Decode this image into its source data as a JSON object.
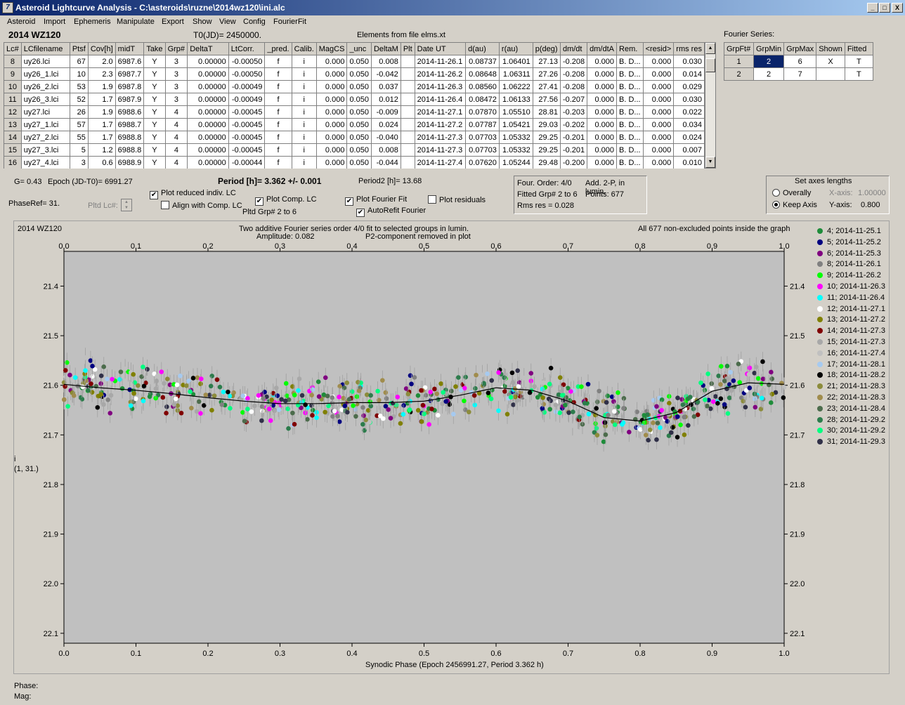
{
  "window": {
    "title": "Asteroid Lightcurve Analysis - C:\\asteroids\\ruzne\\2014wz120\\ini.alc",
    "icon_glyph": "7",
    "buttons": [
      "_",
      "□",
      "X"
    ]
  },
  "menu": [
    "Asteroid",
    "Import",
    "Ephemeris",
    "Manipulate",
    "Export",
    "Show",
    "View",
    "Config",
    "FourierFit"
  ],
  "header": {
    "object": "2014 WZ120",
    "t0": "T0(JD)= 2450000.",
    "elements": "Elements from file elms.xt"
  },
  "lc_table": {
    "columns": [
      "Lc#",
      "LCfilename",
      "Ptsf",
      "Cov[h]",
      "midT",
      "Take",
      "Grp#",
      "DeltaT",
      "LtCorr.",
      "_pred.",
      "Calib.",
      "MagCS",
      "_unc",
      "DeltaM",
      "Plt",
      "Date UT",
      "d(au)",
      "r(au)",
      "p(deg)",
      "dm/dt",
      "dm/dtA",
      "Rem.",
      "<resid>",
      "rms res"
    ],
    "rows": [
      [
        "8",
        "uy26.lci",
        "67",
        "2.0",
        "6987.6",
        "Y",
        "3",
        "0.00000",
        "-0.00050",
        "f",
        "i",
        "0.000",
        "0.050",
        "0.008",
        "",
        "2014-11-26.1",
        "0.08737",
        "1.06401",
        "27.13",
        "-0.208",
        "0.000",
        "B. D...",
        "0.000",
        "0.030"
      ],
      [
        "9",
        "uy26_1.lci",
        "10",
        "2.3",
        "6987.7",
        "Y",
        "3",
        "0.00000",
        "-0.00050",
        "f",
        "i",
        "0.000",
        "0.050",
        "-0.042",
        "",
        "2014-11-26.2",
        "0.08648",
        "1.06311",
        "27.26",
        "-0.208",
        "0.000",
        "B. D...",
        "0.000",
        "0.014"
      ],
      [
        "10",
        "uy26_2.lci",
        "53",
        "1.9",
        "6987.8",
        "Y",
        "3",
        "0.00000",
        "-0.00049",
        "f",
        "i",
        "0.000",
        "0.050",
        "0.037",
        "",
        "2014-11-26.3",
        "0.08560",
        "1.06222",
        "27.41",
        "-0.208",
        "0.000",
        "B. D...",
        "0.000",
        "0.029"
      ],
      [
        "11",
        "uy26_3.lci",
        "52",
        "1.7",
        "6987.9",
        "Y",
        "3",
        "0.00000",
        "-0.00049",
        "f",
        "i",
        "0.000",
        "0.050",
        "0.012",
        "",
        "2014-11-26.4",
        "0.08472",
        "1.06133",
        "27.56",
        "-0.207",
        "0.000",
        "B. D...",
        "0.000",
        "0.030"
      ],
      [
        "12",
        "uy27.lci",
        "26",
        "1.9",
        "6988.6",
        "Y",
        "4",
        "0.00000",
        "-0.00045",
        "f",
        "i",
        "0.000",
        "0.050",
        "-0.009",
        "",
        "2014-11-27.1",
        "0.07870",
        "1.05510",
        "28.81",
        "-0.203",
        "0.000",
        "B. D...",
        "0.000",
        "0.022"
      ],
      [
        "13",
        "uy27_1.lci",
        "57",
        "1.7",
        "6988.7",
        "Y",
        "4",
        "0.00000",
        "-0.00045",
        "f",
        "i",
        "0.000",
        "0.050",
        "0.024",
        "",
        "2014-11-27.2",
        "0.07787",
        "1.05421",
        "29.03",
        "-0.202",
        "0.000",
        "B. D...",
        "0.000",
        "0.034"
      ],
      [
        "14",
        "uy27_2.lci",
        "55",
        "1.7",
        "6988.8",
        "Y",
        "4",
        "0.00000",
        "-0.00045",
        "f",
        "i",
        "0.000",
        "0.050",
        "-0.040",
        "",
        "2014-11-27.3",
        "0.07703",
        "1.05332",
        "29.25",
        "-0.201",
        "0.000",
        "B. D...",
        "0.000",
        "0.024"
      ],
      [
        "15",
        "uy27_3.lci",
        "5",
        "1.2",
        "6988.8",
        "Y",
        "4",
        "0.00000",
        "-0.00045",
        "f",
        "i",
        "0.000",
        "0.050",
        "0.008",
        "",
        "2014-11-27.3",
        "0.07703",
        "1.05332",
        "29.25",
        "-0.201",
        "0.000",
        "B. D...",
        "0.000",
        "0.007"
      ],
      [
        "16",
        "uy27_4.lci",
        "3",
        "0.6",
        "6988.9",
        "Y",
        "4",
        "0.00000",
        "-0.00044",
        "f",
        "i",
        "0.000",
        "0.050",
        "-0.044",
        "",
        "2014-11-27.4",
        "0.07620",
        "1.05244",
        "29.48",
        "-0.200",
        "0.000",
        "B. D...",
        "0.000",
        "0.010"
      ]
    ]
  },
  "fourier_series": {
    "label": "Fourier Series:",
    "columns": [
      "GrpFt#",
      "GrpMin",
      "GrpMax",
      "Shown",
      "Fitted"
    ],
    "rows": [
      [
        "1",
        "2",
        "6",
        "X",
        "T"
      ],
      [
        "2",
        "2",
        "7",
        "",
        "T"
      ]
    ]
  },
  "controls": {
    "g": "G= 0.43",
    "epoch": "Epoch (JD-T0)= 6991.27",
    "period": "Period [h]= 3.362 +/- 0.001",
    "period2": "Period2 [h]= 13.68",
    "phaseref": "PhaseRef= 31.",
    "pltd_lc": "Pltd Lc#:",
    "plot_reduced": "Plot reduced indiv. LC",
    "align_comp": "Align with Comp. LC",
    "plot_comp": "Plot Comp. LC",
    "pltd_grp": "Pltd Grp#  2   to   6",
    "plot_fourier": "Plot Fourier Fit",
    "autorefit": "AutoRefit Fourier",
    "plot_residuals": "Plot residuals",
    "checkmark": "✔",
    "info_order": "Four. Order:  4/0",
    "info_fitted": "Fitted Grp# 2 to 6",
    "info_rms": "Rms res     = 0.028",
    "info_add": "Add. 2-P, in lumin.",
    "info_points": "Points: 677",
    "axes_title": "Set axes lengths",
    "overally": "Overally",
    "keep_axis": "Keep Axis",
    "xaxis_label": "X-axis:",
    "xaxis_value": "1.00000",
    "yaxis_label": "Y-axis:",
    "yaxis_value": "0.800"
  },
  "chart_data": {
    "type": "scatter",
    "title": "Two additive Fourier series order 4/0 fit to selected groups in lumin.",
    "subtitle_left": "Amplitude: 0.082",
    "subtitle_right": "P2-component removed in plot",
    "corner_left": "2014 WZ120",
    "corner_right": "All 677 non-excluded points inside the graph",
    "xlabel": "Synodic Phase (Epoch 2456991.27, Period 3.362 h)",
    "ylabel": "i",
    "ylabel2": "(1, 31.)",
    "xlim": [
      0,
      1
    ],
    "ylim": [
      22.12,
      21.33
    ],
    "xticks": [
      "0.0",
      "0.1",
      "0.2",
      "0.3",
      "0.4",
      "0.5",
      "0.6",
      "0.7",
      "0.8",
      "0.9",
      "1.0"
    ],
    "yticks": [
      "21.4",
      "21.5",
      "21.6",
      "21.7",
      "21.8",
      "21.9",
      "22.0",
      "22.1"
    ],
    "fit_curve": {
      "x": [
        0,
        0.05,
        0.1,
        0.15,
        0.2,
        0.25,
        0.3,
        0.35,
        0.4,
        0.45,
        0.5,
        0.55,
        0.6,
        0.65,
        0.7,
        0.75,
        0.8,
        0.85,
        0.9,
        0.95,
        1.0
      ],
      "y": [
        21.598,
        21.605,
        21.61,
        21.617,
        21.625,
        21.632,
        21.637,
        21.637,
        21.635,
        21.635,
        21.632,
        21.62,
        21.605,
        21.61,
        21.632,
        21.665,
        21.672,
        21.655,
        21.612,
        21.595,
        21.598
      ]
    },
    "legend": [
      {
        "name": "4; 2014-11-25.1",
        "color": "#1e8c3a"
      },
      {
        "name": "5; 2014-11-25.2",
        "color": "#000080"
      },
      {
        "name": "6; 2014-11-25.3",
        "color": "#800080"
      },
      {
        "name": "8; 2014-11-26.1",
        "color": "#808080"
      },
      {
        "name": "9; 2014-11-26.2",
        "color": "#00ff00"
      },
      {
        "name": "10; 2014-11-26.3",
        "color": "#ff00ff"
      },
      {
        "name": "11; 2014-11-26.4",
        "color": "#00ffff"
      },
      {
        "name": "12; 2014-11-27.1",
        "color": "#ffffff"
      },
      {
        "name": "13; 2014-11-27.2",
        "color": "#808000"
      },
      {
        "name": "14; 2014-11-27.3",
        "color": "#800000"
      },
      {
        "name": "15; 2014-11-27.3",
        "color": "#a8a8a8"
      },
      {
        "name": "16; 2014-11-27.4",
        "color": "#c0c0c0"
      },
      {
        "name": "17; 2014-11-28.1",
        "color": "#a6caf0"
      },
      {
        "name": "18; 2014-11-28.2",
        "color": "#000000"
      },
      {
        "name": "21; 2014-11-28.3",
        "color": "#8c8c3c"
      },
      {
        "name": "22; 2014-11-28.3",
        "color": "#a08c4c"
      },
      {
        "name": "23; 2014-11-28.4",
        "color": "#4c6c4c"
      },
      {
        "name": "28; 2014-11-29.2",
        "color": "#2c7c4c"
      },
      {
        "name": "30; 2014-11-29.2",
        "color": "#00ff80"
      },
      {
        "name": "31; 2014-11-29.3",
        "color": "#303048"
      }
    ]
  },
  "status": {
    "phase": "Phase:",
    "mag": "Mag:"
  }
}
